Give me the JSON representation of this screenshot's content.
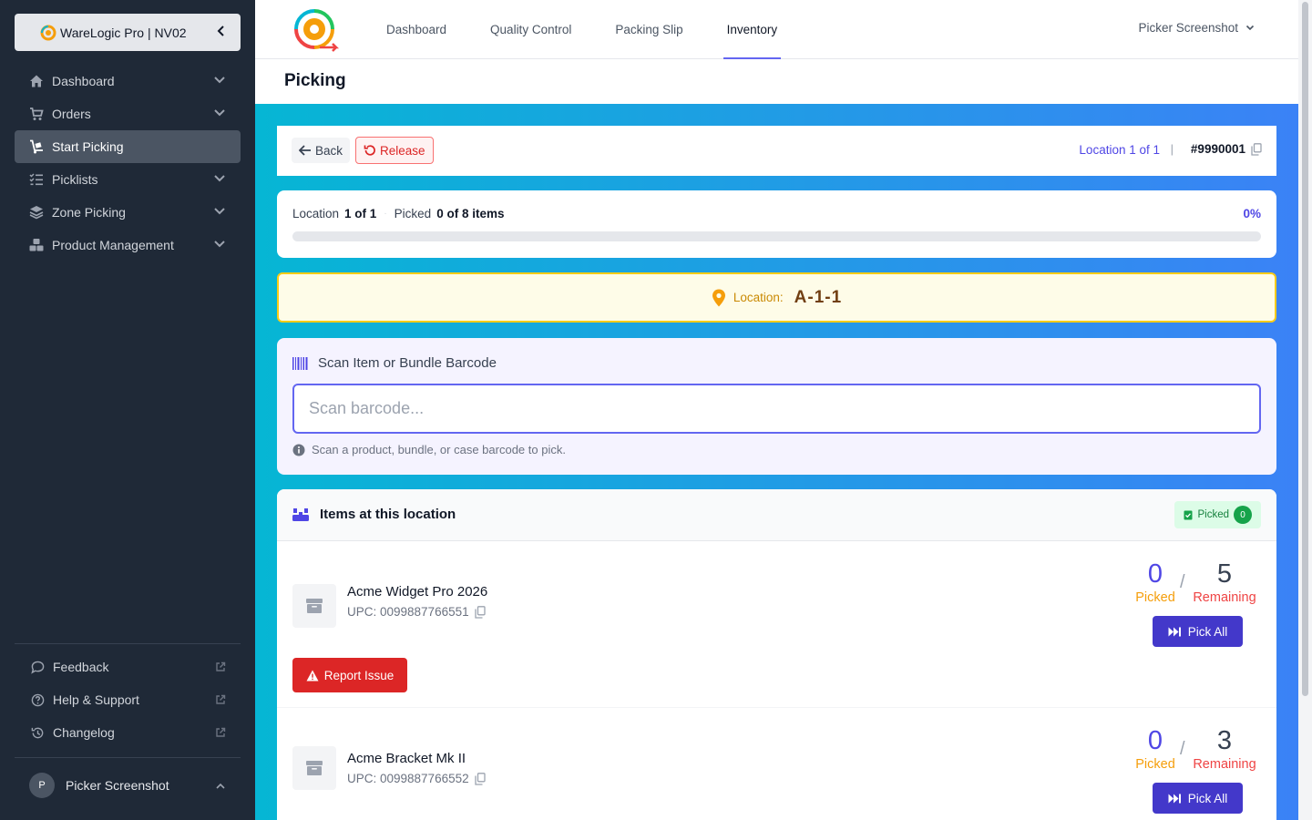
{
  "sidebar": {
    "brand": "WareLogic Pro | NV02",
    "items": [
      {
        "label": "Dashboard",
        "icon": "home-icon"
      },
      {
        "label": "Orders",
        "icon": "cart-icon"
      },
      {
        "label": "Start Picking",
        "icon": "trolley-icon",
        "active": true
      },
      {
        "label": "Picklists",
        "icon": "list-check-icon"
      },
      {
        "label": "Zone Picking",
        "icon": "layers-icon"
      },
      {
        "label": "Product Management",
        "icon": "boxes-icon"
      }
    ],
    "bottom": [
      {
        "label": "Feedback",
        "icon": "comment-icon"
      },
      {
        "label": "Help & Support",
        "icon": "question-icon"
      },
      {
        "label": "Changelog",
        "icon": "history-icon"
      }
    ],
    "user": {
      "initial": "P",
      "name": "Picker Screenshot"
    }
  },
  "topnav": {
    "tabs": [
      "Dashboard",
      "Quality Control",
      "Packing Slip",
      "Inventory"
    ],
    "active_tab": "Inventory",
    "user": "Picker Screenshot"
  },
  "page": {
    "title": "Picking"
  },
  "actions": {
    "back": "Back",
    "release": "Release",
    "location_of": "Location 1 of 1",
    "order_number": "#9990001"
  },
  "progress": {
    "location_label": "Location",
    "location_value": "1 of 1",
    "picked_label": "Picked",
    "picked_value": "0 of 8 items",
    "percent_text": "0%",
    "percent": 0
  },
  "location": {
    "label": "Location:",
    "value": "A-1-1"
  },
  "scan": {
    "title": "Scan Item or Bundle Barcode",
    "placeholder": "Scan barcode...",
    "value": "",
    "hint": "Scan a product, bundle, or case barcode to pick."
  },
  "items_section": {
    "title": "Items at this location",
    "picked_badge": "Picked",
    "picked_count": "0"
  },
  "items": [
    {
      "name": "Acme Widget Pro 2026",
      "upc": "UPC: 0099887766551",
      "picked": "0",
      "remaining": "5",
      "picked_label": "Picked",
      "remaining_label": "Remaining",
      "pick_all": "Pick All",
      "report": "Report Issue"
    },
    {
      "name": "Acme Bracket Mk II",
      "upc": "UPC: 0099887766552",
      "picked": "0",
      "remaining": "3",
      "picked_label": "Picked",
      "remaining_label": "Remaining",
      "pick_all": "Pick All"
    }
  ],
  "colors": {
    "accent": "#4f46e5",
    "danger": "#dc2626",
    "warning": "#facc15",
    "sidebar": "#1f2937"
  }
}
